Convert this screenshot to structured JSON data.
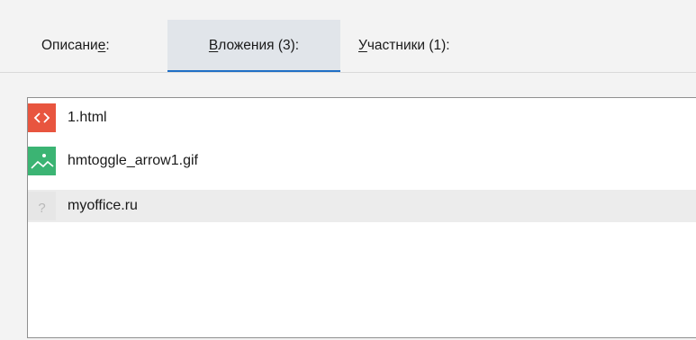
{
  "tabs": [
    {
      "label_before": "Описани",
      "label_underline": "е",
      "label_after": ":",
      "active": false
    },
    {
      "label_before": "",
      "label_underline": "В",
      "label_after": "ложения (3):",
      "active": true
    },
    {
      "label_before": "",
      "label_underline": "У",
      "label_after": "частники (1):",
      "active": false
    }
  ],
  "attachments": [
    {
      "name": "1.html",
      "icon": "code-file-icon",
      "color": "#e8553f",
      "selected": false
    },
    {
      "name": "hmtoggle_arrow1.gif",
      "icon": "image-file-icon",
      "color": "#3bb473",
      "selected": false
    },
    {
      "name": "myoffice.ru",
      "icon": "unknown-file-icon",
      "color": "#e6e6e6",
      "selected": true
    }
  ],
  "colors": {
    "accent": "#1f6fc5",
    "active_tab_bg": "#e1e5ea"
  }
}
